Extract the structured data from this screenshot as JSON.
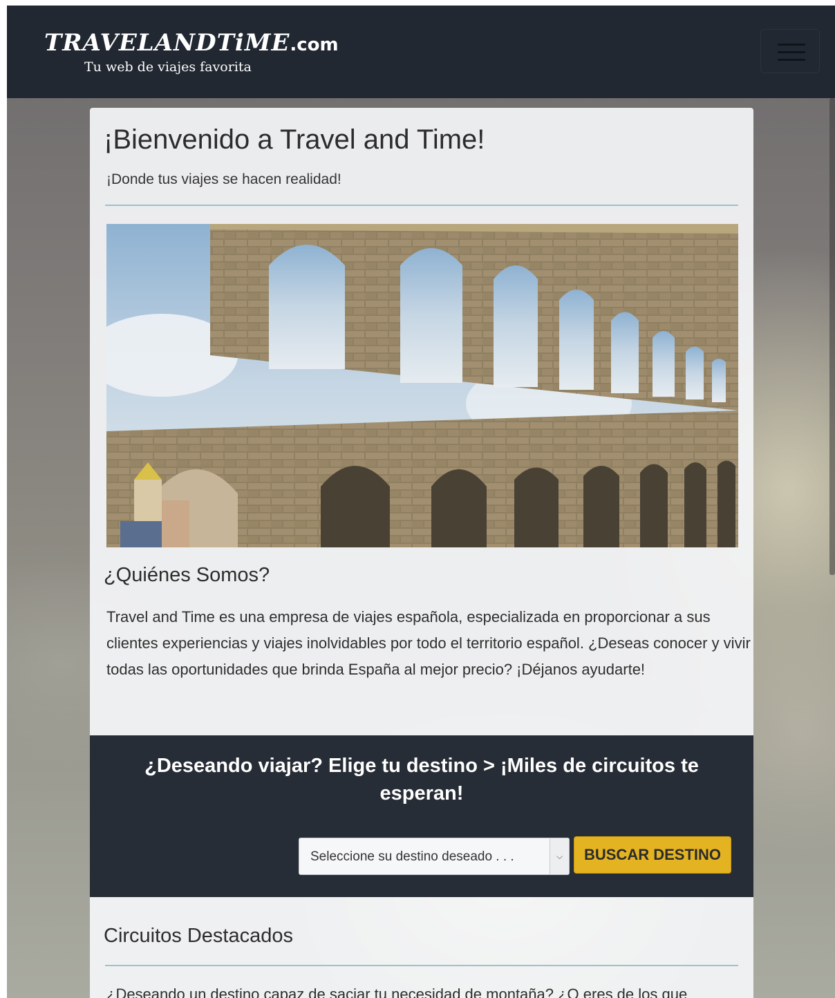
{
  "navbar": {
    "brand_name": "TRAVELANDTiME",
    "brand_suffix": ".com",
    "tagline": "Tu web de viajes favorita",
    "menu_icon": "hamburger-menu-icon"
  },
  "hero": {
    "title": "¡Bienvenido a Travel and Time!",
    "subtitle": "¡Donde tus viajes se hacen realidad!"
  },
  "about": {
    "heading": "¿Quiénes Somos?",
    "text": "Travel and Time es una empresa de viajes española, especializada en proporcionar a sus clientes experiencias y viajes inolvidables por todo el territorio español. ¿Deseas conocer y vivir todas las oportunidades que brinda España al mejor precio? ¡Déjanos ayudarte!"
  },
  "search": {
    "title": "¿Deseando viajar? Elige tu destino > ¡Miles de circuitos te esperan!",
    "select_placeholder": "Seleccione su destino deseado . . .",
    "button_label": "BUSCAR DESTINO"
  },
  "featured": {
    "heading": "Circuitos Destacados",
    "text": "¿Deseando un destino capaz de saciar tu necesidad de montaña? ¿O eres de los que"
  },
  "colors": {
    "navbar_bg": "#212832",
    "accent_button": "#e4b322",
    "divider": "#9cc3c8"
  }
}
